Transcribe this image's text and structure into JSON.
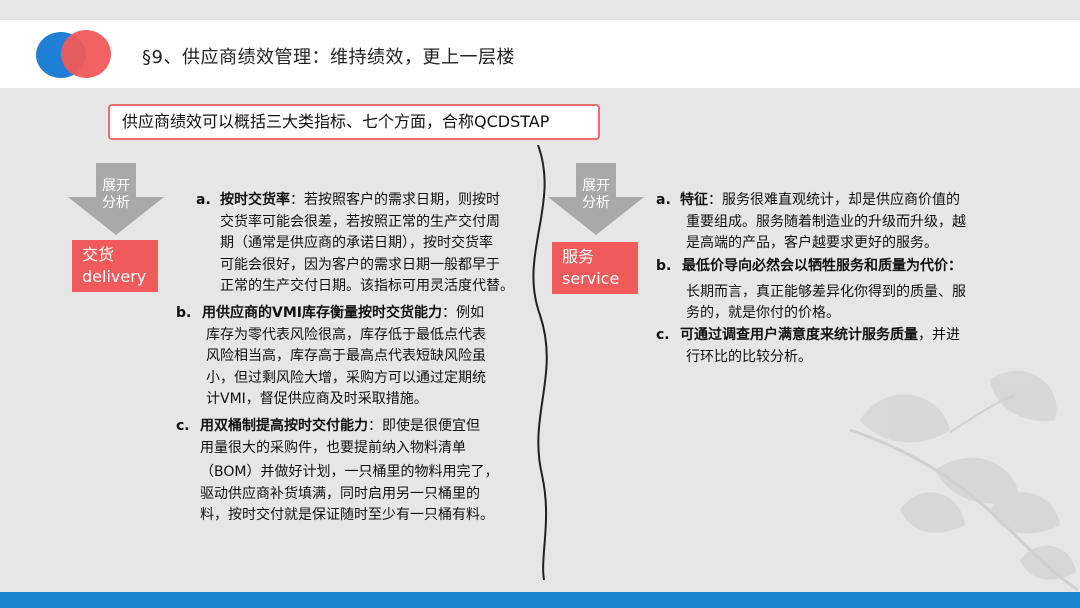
{
  "header": {
    "title": "§9、供应商绩效管理：维持绩效，更上一层楼"
  },
  "summary": "供应商绩效可以概括三大类指标、七个方面，合称QCDSTAP",
  "left": {
    "arrow_text": [
      "展开",
      "分析"
    ],
    "tag": [
      "交货",
      "delivery"
    ],
    "items": [
      {
        "label": "a.",
        "title": "按时交货率",
        "text": "：若按照客户的需求日期，则按时交货率可能会很差，若按照正常的生产交付周期（通常是供应商的承诺日期），按时交货率可能会很好，因为客户的需求日期一般都早于正常的生产交付日期。该指标可用灵活度代替。",
        "lines": [
          "按时交货率：若按照客户的需求日期，则按时",
          "交货率可能会很差，若按照正常的生产交付周",
          "期（通常是供应商的承诺日期），按时交货率",
          "可能会很好，因为客户的需求日期一般都早于",
          "正常的生产交付日期。该指标可用灵活度代替。"
        ]
      },
      {
        "label": "b.",
        "lines": [
          "用供应商的VMI库存衡量按时交货能力：例如",
          "库存为零代表风险很高，库存低于最低点代表",
          "风险相当高，库存高于最高点代表短缺风险虽",
          "小，但过剩风险大增，采购方可以通过定期统",
          "计VMI，督促供应商及时采取措施。"
        ]
      },
      {
        "label": "c.",
        "lines": [
          "用双桶制提高按时交付能力：即使是很便宜但",
          "用量很大的采购件，也要提前纳入物料清单",
          "（BOM）并做好计划，一只桶里的物料用完了，",
          "驱动供应商补货填满，同时启用另一只桶里的",
          "料，按时交付就是保证随时至少有一只桶有料。"
        ]
      }
    ]
  },
  "right": {
    "arrow_text": [
      "展开",
      "分析"
    ],
    "tag": [
      "服务",
      "service"
    ],
    "items": [
      {
        "label": "a.",
        "lines": [
          "特征：服务很难直观统计，却是供应商价值的",
          "重要组成。服务随着制造业的升级而升级，越",
          "是高端的产品，客户越要求更好的服务。"
        ]
      },
      {
        "label": "b.",
        "lines": [
          "最低价导向必然会以牺牲服务和质量为代价：",
          "长期而言，真正能够差异化你得到的质量、服",
          "务的，就是你付的价格。"
        ]
      },
      {
        "label": "c.",
        "lines": [
          "可通过调查用户满意度来统计服务质量，并进",
          "行环比的比较分析。"
        ]
      }
    ]
  },
  "colors": {
    "accent_red": "#f05a5a",
    "accent_blue": "#1a86d0",
    "arrow_gray": "#a9a9a9"
  }
}
